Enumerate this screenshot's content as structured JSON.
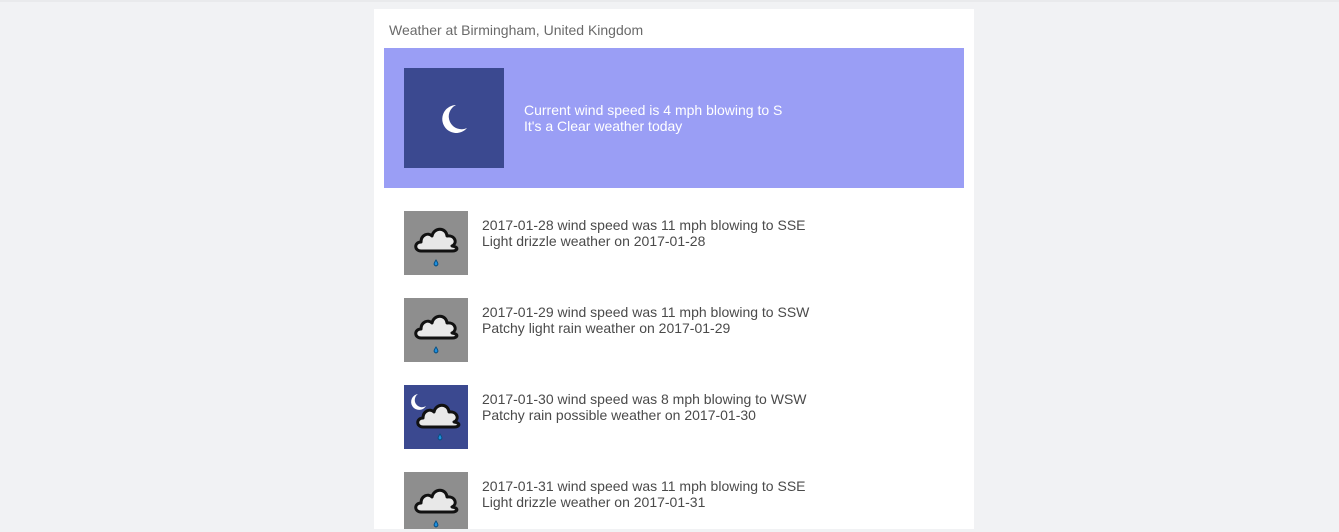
{
  "location": "Weather at Birmingham, United Kingdom",
  "current": {
    "icon": "clear-night-moon-icon",
    "wind_line": "Current wind speed is 4 mph blowing to S",
    "weather_line": "It's a Clear weather today",
    "background_color": "#9a9ef5",
    "icon_bg_color": "#3b4990"
  },
  "forecast": [
    {
      "icon": "light-drizzle-cloud-icon",
      "wind_line": "2017-01-28 wind speed was 11 mph blowing to SSE",
      "weather_line": "Light drizzle weather on 2017-01-28"
    },
    {
      "icon": "light-rain-cloud-icon",
      "wind_line": "2017-01-29 wind speed was 11 mph blowing to SSW",
      "weather_line": "Patchy light rain weather on 2017-01-29"
    },
    {
      "icon": "night-rain-cloud-moon-icon",
      "wind_line": "2017-01-30 wind speed was 8 mph blowing to WSW",
      "weather_line": "Patchy rain possible weather on 2017-01-30"
    },
    {
      "icon": "light-drizzle-cloud-icon",
      "wind_line": "2017-01-31 wind speed was 11 mph blowing to SSE",
      "weather_line": "Light drizzle weather on 2017-01-31"
    }
  ]
}
